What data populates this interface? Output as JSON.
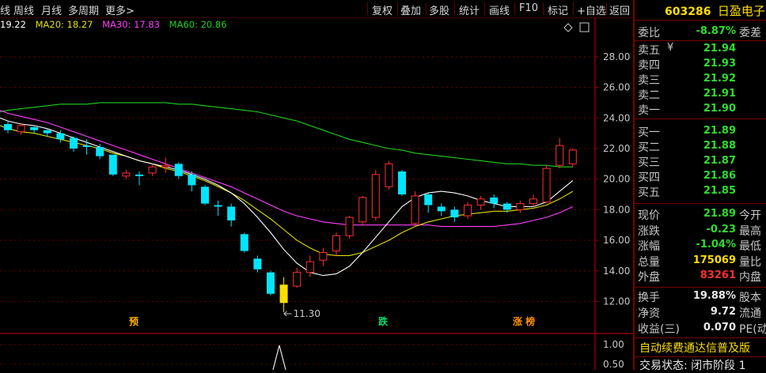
{
  "toolbar": {
    "left": [
      "线",
      "周线",
      "月线",
      "多周期",
      "更多>"
    ],
    "right": [
      "复权",
      "叠加",
      "多股",
      "统计",
      "画线",
      "F10",
      "标记",
      "+自选",
      "返回"
    ]
  },
  "ma": {
    "ma10": "19.22",
    "ma20": "MA20: 18.27",
    "ma30": "MA30: 17.83",
    "ma60": "MA60: 20.86"
  },
  "colors": {
    "up": "#ff3030",
    "down": "#00e5ff",
    "ma10": "#ffffff",
    "ma20": "#e0e000",
    "ma30": "#ff40ff",
    "ma60": "#20d020"
  },
  "chart_data": {
    "type": "candlestick",
    "ylim": [
      11.3,
      29.0
    ],
    "y_ticks": [
      "28.00",
      "26.00",
      "24.00",
      "22.00",
      "20.00",
      "18.00",
      "16.00",
      "14.00",
      "12.00"
    ],
    "low_annotation": "11.30",
    "markers": [
      "预",
      "跌",
      "涨 榜"
    ],
    "candles": [
      {
        "o": 23.6,
        "c": 23.2,
        "h": 23.8,
        "l": 23.0
      },
      {
        "o": 23.1,
        "c": 23.5,
        "h": 23.7,
        "l": 22.9
      },
      {
        "o": 23.4,
        "c": 23.2,
        "h": 23.5,
        "l": 23.0
      },
      {
        "o": 23.2,
        "c": 23.0,
        "h": 23.3,
        "l": 22.8
      },
      {
        "o": 23.0,
        "c": 22.6,
        "h": 23.2,
        "l": 22.4
      },
      {
        "o": 22.7,
        "c": 22.0,
        "h": 22.8,
        "l": 21.8
      },
      {
        "o": 22.2,
        "c": 22.1,
        "h": 22.6,
        "l": 21.6
      },
      {
        "o": 22.1,
        "c": 21.5,
        "h": 22.3,
        "l": 21.3
      },
      {
        "o": 21.6,
        "c": 20.3,
        "h": 21.6,
        "l": 20.2
      },
      {
        "o": 20.2,
        "c": 20.4,
        "h": 20.6,
        "l": 20.0
      },
      {
        "o": 20.3,
        "c": 20.2,
        "h": 20.5,
        "l": 19.6
      },
      {
        "o": 20.4,
        "c": 20.8,
        "h": 21.0,
        "l": 20.2
      },
      {
        "o": 20.8,
        "c": 20.9,
        "h": 21.4,
        "l": 20.4
      },
      {
        "o": 21.0,
        "c": 20.2,
        "h": 21.1,
        "l": 20.0
      },
      {
        "o": 20.3,
        "c": 19.6,
        "h": 20.5,
        "l": 19.2
      },
      {
        "o": 19.5,
        "c": 18.4,
        "h": 19.6,
        "l": 18.3
      },
      {
        "o": 18.3,
        "c": 18.2,
        "h": 18.6,
        "l": 17.6
      },
      {
        "o": 18.2,
        "c": 17.3,
        "h": 18.4,
        "l": 16.9
      },
      {
        "o": 16.4,
        "c": 15.3,
        "h": 16.5,
        "l": 15.2
      },
      {
        "o": 14.8,
        "c": 14.1,
        "h": 15.0,
        "l": 13.9
      },
      {
        "o": 13.9,
        "c": 12.5,
        "h": 14.0,
        "l": 12.4
      },
      {
        "o": 11.9,
        "c": 13.1,
        "h": 13.6,
        "l": 11.3
      },
      {
        "o": 13.0,
        "c": 13.9,
        "h": 14.2,
        "l": 12.9
      },
      {
        "o": 13.9,
        "c": 14.6,
        "h": 15.0,
        "l": 13.6
      },
      {
        "o": 14.7,
        "c": 15.2,
        "h": 15.5,
        "l": 14.3
      },
      {
        "o": 15.3,
        "c": 16.3,
        "h": 16.5,
        "l": 15.0
      },
      {
        "o": 16.3,
        "c": 17.5,
        "h": 17.6,
        "l": 16.1
      },
      {
        "o": 17.2,
        "c": 18.8,
        "h": 18.9,
        "l": 17.0
      },
      {
        "o": 17.5,
        "c": 20.3,
        "h": 20.6,
        "l": 17.3
      },
      {
        "o": 19.5,
        "c": 21.0,
        "h": 21.2,
        "l": 19.3
      },
      {
        "o": 20.5,
        "c": 19.0,
        "h": 20.6,
        "l": 18.9
      },
      {
        "o": 17.1,
        "c": 18.9,
        "h": 19.2,
        "l": 16.9
      },
      {
        "o": 19.0,
        "c": 18.3,
        "h": 19.1,
        "l": 17.8
      },
      {
        "o": 18.2,
        "c": 17.9,
        "h": 18.4,
        "l": 17.6
      },
      {
        "o": 18.0,
        "c": 17.5,
        "h": 18.2,
        "l": 17.2
      },
      {
        "o": 17.6,
        "c": 18.3,
        "h": 18.5,
        "l": 17.4
      },
      {
        "o": 18.3,
        "c": 18.7,
        "h": 18.9,
        "l": 18.0
      },
      {
        "o": 18.8,
        "c": 18.4,
        "h": 19.0,
        "l": 18.1
      },
      {
        "o": 18.4,
        "c": 18.0,
        "h": 18.5,
        "l": 17.8
      },
      {
        "o": 18.0,
        "c": 18.4,
        "h": 18.6,
        "l": 17.8
      },
      {
        "o": 18.4,
        "c": 18.7,
        "h": 19.0,
        "l": 18.2
      },
      {
        "o": 18.5,
        "c": 20.7,
        "h": 20.9,
        "l": 18.4
      },
      {
        "o": 20.9,
        "c": 22.2,
        "h": 22.7,
        "l": 20.7
      },
      {
        "o": 21.0,
        "c": 21.9,
        "h": 22.0,
        "l": 20.8
      }
    ],
    "ma10": [
      23.8,
      23.6,
      23.5,
      23.3,
      23.0,
      22.7,
      22.4,
      22.1,
      21.8,
      21.5,
      21.2,
      21.0,
      20.8,
      20.6,
      20.3,
      20.0,
      19.6,
      19.1,
      18.4,
      17.5,
      16.5,
      15.4,
      14.5,
      13.9,
      13.7,
      13.8,
      14.3,
      15.2,
      16.2,
      17.2,
      18.2,
      18.8,
      19.1,
      19.2,
      19.1,
      18.9,
      18.6,
      18.4,
      18.2,
      18.2,
      18.2,
      18.5,
      19.2,
      19.9
    ],
    "ma20": [
      23.3,
      23.1,
      23.0,
      22.8,
      22.6,
      22.4,
      22.2,
      22.0,
      21.7,
      21.5,
      21.2,
      21.0,
      20.7,
      20.5,
      20.2,
      19.9,
      19.5,
      19.1,
      18.6,
      18.0,
      17.4,
      16.7,
      16.0,
      15.5,
      15.1,
      15.0,
      15.0,
      15.2,
      15.6,
      16.0,
      16.5,
      16.9,
      17.2,
      17.4,
      17.6,
      17.7,
      17.8,
      17.9,
      17.9,
      18.0,
      18.1,
      18.3,
      18.7,
      19.2
    ],
    "ma30": [
      24.3,
      24.1,
      23.9,
      23.7,
      23.4,
      23.1,
      22.8,
      22.5,
      22.2,
      21.9,
      21.6,
      21.3,
      21.0,
      20.7,
      20.4,
      20.1,
      19.8,
      19.5,
      19.1,
      18.7,
      18.3,
      17.9,
      17.6,
      17.4,
      17.2,
      17.1,
      17.0,
      17.0,
      17.0,
      17.0,
      17.0,
      17.0,
      17.0,
      16.9,
      16.9,
      16.9,
      16.9,
      16.9,
      17.0,
      17.1,
      17.3,
      17.5,
      17.8,
      18.2
    ],
    "ma60": [
      24.5,
      24.6,
      24.7,
      24.8,
      24.9,
      24.9,
      24.9,
      25.0,
      25.0,
      25.0,
      25.0,
      25.0,
      25.0,
      24.9,
      24.9,
      24.8,
      24.7,
      24.6,
      24.5,
      24.4,
      24.2,
      24.0,
      23.8,
      23.5,
      23.2,
      22.9,
      22.6,
      22.4,
      22.2,
      22.0,
      21.9,
      21.7,
      21.6,
      21.5,
      21.4,
      21.3,
      21.2,
      21.1,
      21.0,
      21.0,
      20.9,
      20.9,
      20.8,
      20.8
    ],
    "sub_ticks": [
      "1.00",
      "0.50"
    ]
  },
  "panel": {
    "code": "603286",
    "name": "日盈电子",
    "weibi": {
      "label": "委比",
      "value": "-8.87%",
      "extra": "委差"
    },
    "sells": [
      {
        "label": "卖五",
        "value": "21.94"
      },
      {
        "label": "卖四",
        "value": "21.93"
      },
      {
        "label": "卖三",
        "value": "21.92"
      },
      {
        "label": "卖二",
        "value": "21.91"
      },
      {
        "label": "卖一",
        "value": "21.90"
      }
    ],
    "buys": [
      {
        "label": "买一",
        "value": "21.89"
      },
      {
        "label": "买二",
        "value": "21.88"
      },
      {
        "label": "买三",
        "value": "21.87"
      },
      {
        "label": "买四",
        "value": "21.86"
      },
      {
        "label": "买五",
        "value": "21.85"
      }
    ],
    "yen": "¥",
    "stats": [
      {
        "label": "现价",
        "value": "21.89",
        "extra": "今开",
        "color": "green"
      },
      {
        "label": "涨跌",
        "value": "-0.23",
        "extra": "最高",
        "color": "green"
      },
      {
        "label": "涨幅",
        "value": "-1.04%",
        "extra": "最低",
        "color": "green"
      },
      {
        "label": "总量",
        "value": "175069",
        "extra": "量比",
        "color": "yellow"
      },
      {
        "label": "外盘",
        "value": "83261",
        "extra": "内盘",
        "color": "red"
      }
    ],
    "fin": [
      {
        "label": "换手",
        "value": "19.88%",
        "extra": "股本"
      },
      {
        "label": "净资",
        "value": "9.72",
        "extra": "流通"
      },
      {
        "label": "收益(三)",
        "value": "0.070",
        "extra": "PE(动"
      }
    ],
    "news": "自动续费通达信普及版",
    "status": "交易状态: 闭市阶段 1"
  }
}
